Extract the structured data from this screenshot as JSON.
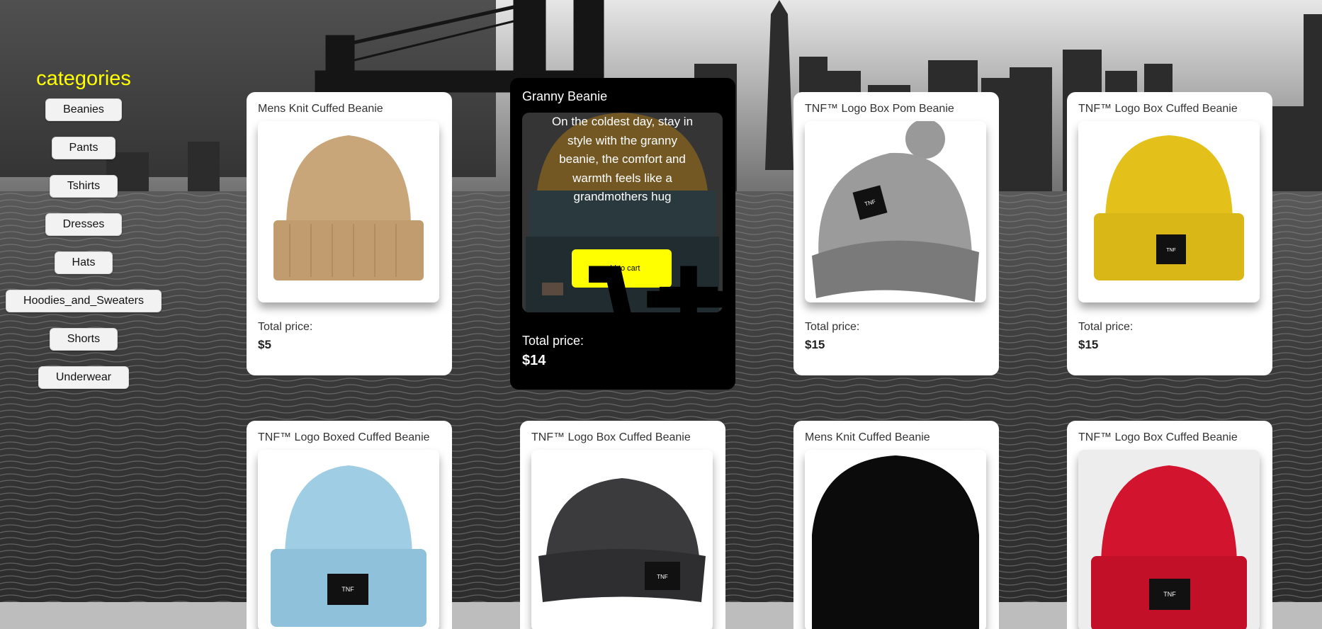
{
  "sidebar": {
    "title": "categories",
    "items": [
      "Beanies",
      "Pants",
      "Tshirts",
      "Dresses",
      "Hats",
      "Hoodies_and_Sweaters",
      "Shorts",
      "Underwear"
    ]
  },
  "products": [
    {
      "title": "Mens Knit Cuffed Beanie",
      "price_label": "Total price:",
      "price": "$5",
      "color": "#c9a57a"
    },
    {
      "title": "Granny Beanie",
      "description": "On the coldest day, stay in style with the granny beanie, the comfort and warmth feels like a grandmothers hug",
      "cart_label": "add to cart",
      "price_label": "Total price:",
      "price": "$14"
    },
    {
      "title": "TNF™ Logo Box Pom Beanie",
      "price_label": "Total price:",
      "price": "$15",
      "color": "#8c8c8c"
    },
    {
      "title": "TNF™ Logo Box Cuffed Beanie",
      "price_label": "Total price:",
      "price": "$15",
      "color": "#e3c11a"
    },
    {
      "title": "TNF™ Logo Boxed Cuffed Beanie",
      "color": "#9fcde3"
    },
    {
      "title": "TNF™ Logo Box Cuffed Beanie",
      "color": "#3b3b3d"
    },
    {
      "title": "Mens Knit Cuffed Beanie",
      "color": "#0b0b0b"
    },
    {
      "title": "TNF™ Logo Box Cuffed Beanie",
      "color": "#d3142f"
    }
  ],
  "icons": {
    "cart": "cart-plus-icon",
    "logo": "north-face-logo"
  }
}
